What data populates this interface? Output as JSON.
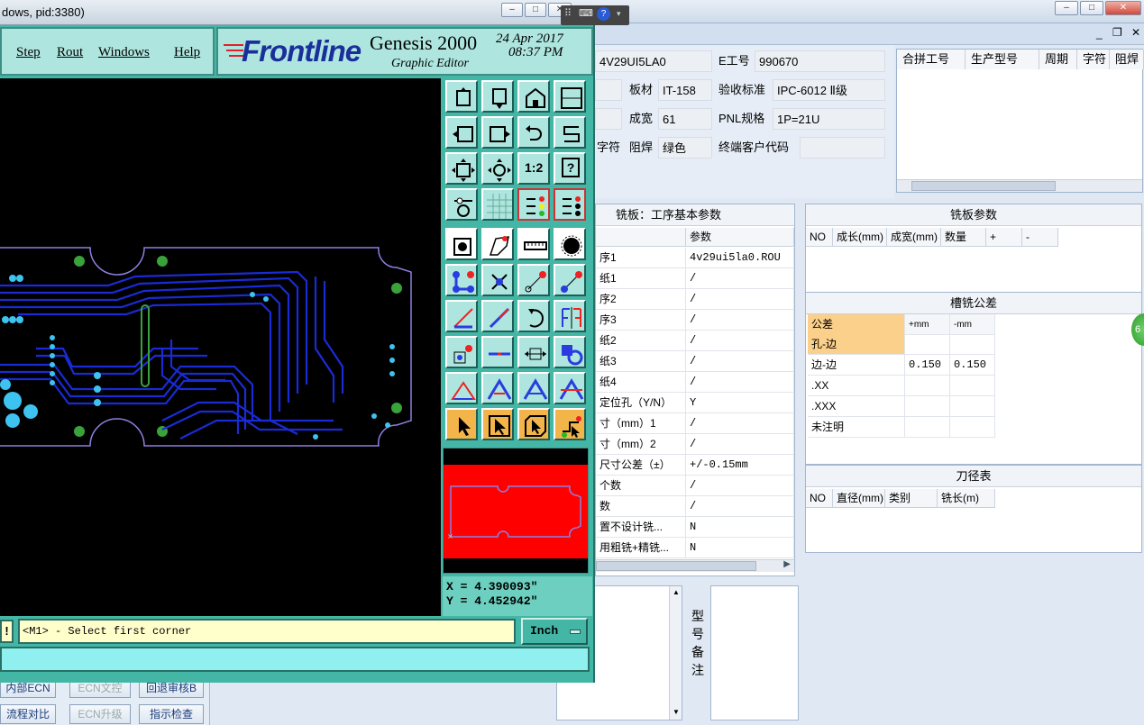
{
  "background_app": {
    "title_fragment": "dows, pid:3380)",
    "window_controls": [
      "–",
      "□",
      "✕"
    ],
    "info": {
      "field_id": "4V29UI5LA0",
      "e_job_label": "E工号",
      "e_job_value": "990670",
      "board_label": "板材",
      "board_value": "IT-158",
      "accept_label": "验收标准",
      "accept_value": "IPC-6012 Ⅱ级",
      "finish_label": "成宽",
      "finish_value": "61",
      "pnl_label": "PNL规格",
      "pnl_value": "1P=21U",
      "char_label": "字符",
      "mask_label": "阻焊",
      "mask_value": "绿色",
      "customer_label": "终端客户代码",
      "customer_value": ""
    },
    "top_grid_headers": [
      "合拼工号",
      "生产型号",
      "周期",
      "字符",
      "阻焊"
    ],
    "mill_panel": {
      "title": "铣板：工序基本参数",
      "col_param": "参数",
      "rows": [
        {
          "name": "序1",
          "value": "4v29ui5la0.ROU"
        },
        {
          "name": "纸1",
          "value": "/"
        },
        {
          "name": "序2",
          "value": "/"
        },
        {
          "name": "序3",
          "value": "/"
        },
        {
          "name": "纸2",
          "value": "/"
        },
        {
          "name": "纸3",
          "value": "/"
        },
        {
          "name": "纸4",
          "value": "/"
        },
        {
          "name": "定位孔（Y/N）",
          "value": "Y"
        },
        {
          "name": "寸（mm）1",
          "value": "/"
        },
        {
          "name": "寸（mm）2",
          "value": "/"
        },
        {
          "name": "尺寸公差（±）",
          "value": "+/-0.15mm"
        },
        {
          "name": "个数",
          "value": "/"
        },
        {
          "name": "数",
          "value": "/"
        },
        {
          "name": "置不设计铣...",
          "value": "N"
        },
        {
          "name": "用粗铣+精铣...",
          "value": "N"
        }
      ]
    },
    "mill_params": {
      "title": "铣板参数",
      "headers": [
        "NO",
        "成长(mm)",
        "成宽(mm)",
        "数量",
        "+",
        "-"
      ]
    },
    "slot_tolerance": {
      "title": "槽铣公差",
      "headers": [
        "公差",
        "+mm",
        "-mm"
      ],
      "rows": [
        {
          "name": "孔-边",
          "plus": "",
          "minus": ""
        },
        {
          "name": "边-边",
          "plus": "0.150",
          "minus": "0.150"
        },
        {
          "name": ".XX",
          "plus": "",
          "minus": ""
        },
        {
          "name": ".XXX",
          "plus": "",
          "minus": ""
        },
        {
          "name": "未注明",
          "plus": "",
          "minus": ""
        }
      ]
    },
    "tool_table": {
      "title": "刀径表",
      "headers": [
        "NO",
        "直径(mm)",
        "类别",
        "铣长(m)"
      ]
    },
    "notes_vertical": [
      "型",
      "号",
      "备",
      "注"
    ],
    "bottom_buttons": [
      {
        "label": "内部ECN",
        "enabled": true
      },
      {
        "label": "ECN文控",
        "enabled": false
      },
      {
        "label": "回退审核B",
        "enabled": true
      },
      {
        "label": "流程对比",
        "enabled": true
      },
      {
        "label": "ECN升级",
        "enabled": false
      },
      {
        "label": "指示检查",
        "enabled": true
      }
    ],
    "badge_text": "6"
  },
  "genesis": {
    "menu": [
      "Step",
      "Rout",
      "Windows",
      "Help"
    ],
    "brand": "Frontline",
    "product": "Genesis 2000",
    "subtitle": "Graphic Editor",
    "date": "24 Apr 2017",
    "time": "08:37 PM",
    "coord_x": "X = 4.390093\"",
    "coord_y": "Y = 4.452942\"",
    "status_message": "<M1> - Select first corner",
    "status_icon": "!",
    "units": "Inch",
    "tool_ratio_label": "1:2",
    "tool_help_label": "?"
  },
  "colors": {
    "genesis_teal": "#44b6a6",
    "genesis_light": "#aee6df",
    "trace_blue": "#1a2bd6",
    "pad_cyan": "#3ec3f0",
    "outline_purple": "#8f7fe0",
    "fiducial_green": "#3aa23a",
    "preview_red": "#ff0000",
    "tool_orange": "#f3b44a"
  }
}
